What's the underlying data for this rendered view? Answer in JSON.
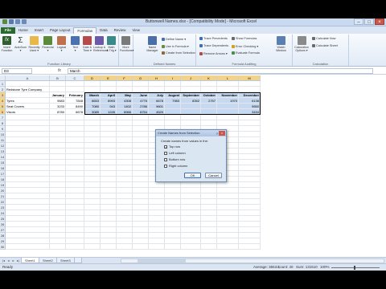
{
  "window": {
    "title": "Buttonwell Names.xlsx - [Compatibility Mode] - Microsoft Excel",
    "min": "–",
    "max": "□",
    "close": "×"
  },
  "tabs": [
    {
      "label": "File"
    },
    {
      "label": "Home"
    },
    {
      "label": "Insert"
    },
    {
      "label": "Page Layout"
    },
    {
      "label": "Formulas"
    },
    {
      "label": "Data"
    },
    {
      "label": "Review"
    },
    {
      "label": "View"
    }
  ],
  "ribbon": {
    "function_library": {
      "name": "Function Library",
      "insert_function": "Insert\nFunction",
      "autosum": "AutoSum\n▾",
      "recently_used": "Recently\nUsed ▾",
      "financial": "Financial\n▾",
      "logical": "Logical\n▾",
      "text": "Text\n▾",
      "date_time": "Date &\nTime ▾",
      "lookup_reference": "Lookup &\nReference▾",
      "math_trig": "Math\n& Trig ▾",
      "more_functions": "More\nFunctions▾"
    },
    "defined_names": {
      "name": "Defined Names",
      "name_manager": "Name\nManager",
      "define_name": "Define Name ▾",
      "use_in_formula": "Use in Formula ▾",
      "create_from_selection": "Create from Selection"
    },
    "formula_auditing": {
      "name": "Formula Auditing",
      "trace_precedents": "Trace Precedents",
      "trace_dependents": "Trace Dependents",
      "remove_arrows": "Remove Arrows ▾",
      "show_formulas": "Show Formulas",
      "error_checking": "Error Checking ▾",
      "evaluate_formula": "Evaluate Formula",
      "watch_window": "Watch\nWindow"
    },
    "calculation": {
      "name": "Calculation",
      "calc_options": "Calculation\nOptions ▾",
      "calc_now": "Calculate Now",
      "calc_sheet": "Calculate Sheet"
    }
  },
  "formula_bar": {
    "name_box": "D3",
    "fx": "fx",
    "content": "March"
  },
  "columns": [
    "A",
    "B",
    "C",
    "D",
    "E",
    "F",
    "G",
    "H",
    "I",
    "J",
    "K",
    "L",
    "M"
  ],
  "rows": [
    "1",
    "2",
    "3",
    "4",
    "5",
    "6",
    "7",
    "8",
    "9",
    "10",
    "11",
    "12",
    "13",
    "14",
    "15",
    "16",
    "17",
    "18",
    "19",
    "20",
    "21",
    "22",
    "23",
    "24",
    "25",
    "26",
    "27",
    "28",
    "29",
    "30"
  ],
  "sheet": {
    "company": "Redstone Tyre Company",
    "months": [
      "January",
      "February",
      "March",
      "April",
      "May",
      "June",
      "July",
      "August",
      "September",
      "October",
      "November",
      "December"
    ],
    "data": [
      {
        "label": "Tyres",
        "values": [
          "9683",
          "7848",
          "8653",
          "8993",
          "4308",
          "4776",
          "6678",
          "7983",
          "8352",
          "2757",
          "1970",
          "6138"
        ]
      },
      {
        "label": "Seat Covers",
        "values": [
          "3233",
          "8490",
          "7080",
          "943",
          "1402",
          "2786",
          "9601",
          "",
          "",
          "",
          "",
          "9550"
        ]
      },
      {
        "label": "Visors",
        "values": [
          "8780",
          "6678",
          "3089",
          "1245",
          "8966",
          "8754",
          "4520",
          "",
          "",
          "",
          "",
          "3434"
        ]
      }
    ]
  },
  "dialog": {
    "title": "Create Names from Selection",
    "help": "?",
    "close": "×",
    "prompt": "Create names from values in the:",
    "options": [
      {
        "label": "Top row",
        "checked": true
      },
      {
        "label": "Left column",
        "checked": false
      },
      {
        "label": "Bottom row",
        "checked": false
      },
      {
        "label": "Right column",
        "checked": false
      }
    ],
    "ok": "OK",
    "cancel": "Cancel"
  },
  "sheet_tabs": [
    "Sheet1",
    "Sheet2",
    "Sheet3"
  ],
  "status": {
    "ready": "Ready",
    "average": "Average: 3653.1",
    "count": "Count: 40",
    "sum": "Sum: 131510",
    "zoom": "100%"
  }
}
